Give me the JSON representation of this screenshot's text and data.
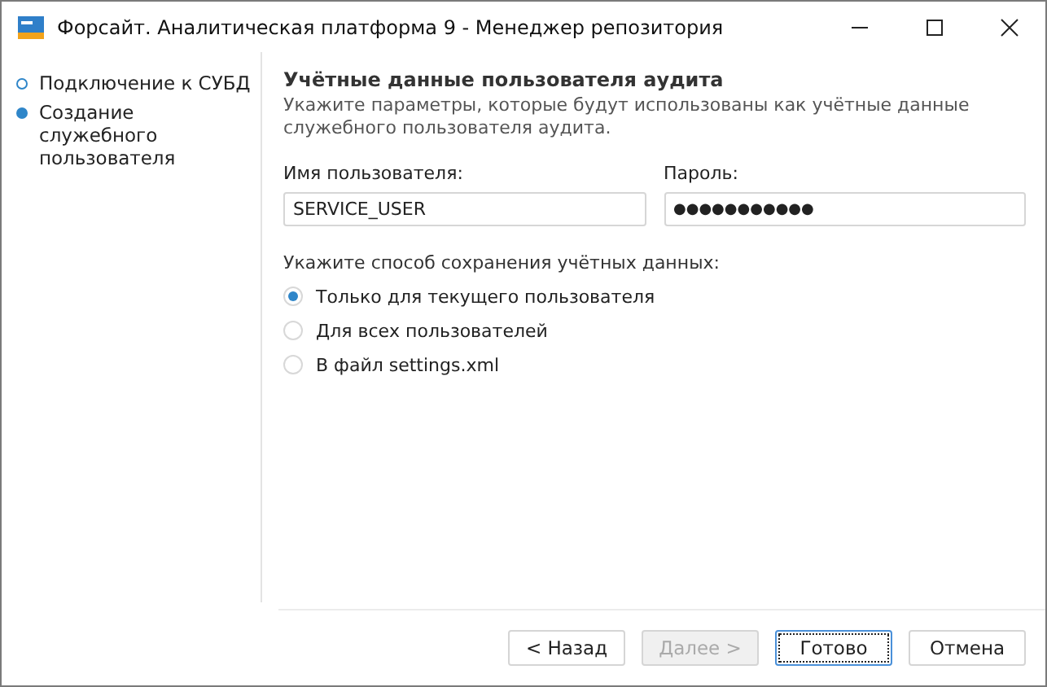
{
  "window": {
    "title": "Форсайт. Аналитическая платформа 9 - Менеджер репозитория"
  },
  "steps": [
    {
      "label": "Подключение к СУБД",
      "selected": false
    },
    {
      "label": "Создание служебного пользователя",
      "selected": true
    }
  ],
  "section": {
    "title": "Учётные данные пользователя аудита",
    "description": "Укажите параметры, которые будут использованы как учётные данные служебного пользователя аудита."
  },
  "fields": [
    {
      "label": "Имя пользователя:",
      "value": "SERVICE_USER",
      "kind": "text"
    },
    {
      "label": "Пароль:",
      "value": "●●●●●●●●●●●",
      "kind": "password"
    }
  ],
  "save_mode": {
    "label": "Укажите способ сохранения учётных данных:",
    "options": [
      {
        "label": "Только для текущего пользователя",
        "selected": true
      },
      {
        "label": "Для всех пользователей",
        "selected": false
      },
      {
        "label": "В файл settings.xml",
        "selected": false
      }
    ]
  },
  "buttons": [
    {
      "label": "< Назад",
      "disabled": false,
      "focused": false
    },
    {
      "label": "Далее >",
      "disabled": true,
      "focused": false
    },
    {
      "label": "Готово",
      "disabled": false,
      "focused": true
    },
    {
      "label": "Отмена",
      "disabled": false,
      "focused": false
    }
  ]
}
